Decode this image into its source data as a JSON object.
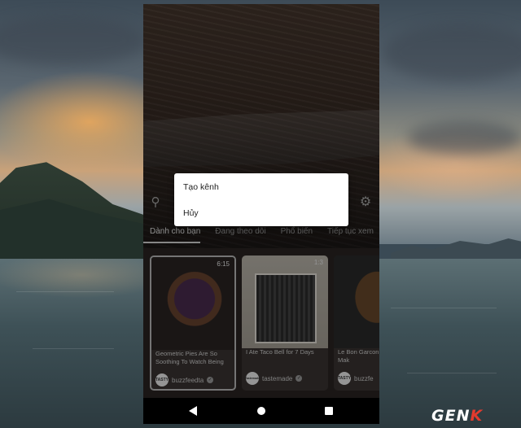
{
  "menu": {
    "items": [
      {
        "label": "Tạo kênh"
      },
      {
        "label": "Hủy"
      }
    ]
  },
  "tabs": [
    {
      "label": "Dành cho bạn",
      "active": true
    },
    {
      "label": "Đang theo dõi"
    },
    {
      "label": "Phổ biến"
    },
    {
      "label": "Tiếp tục xem"
    }
  ],
  "cards": [
    {
      "title": "Geometric Pies Are So Soothing To Watch Being",
      "duration": "6:15",
      "channel": "buzzfeedta",
      "avatar": "TASTY",
      "verified": true
    },
    {
      "title": "I Ate Taco Bell for 7 Days",
      "duration": "1:3",
      "channel": "tastemade",
      "avatar": "Tastemade",
      "verified": true
    },
    {
      "title": "Le Bon Garcon That Will Mak",
      "duration": "",
      "channel": "buzzfe",
      "avatar": "TASTY",
      "verified": false
    }
  ],
  "icons": {
    "search": "search-icon",
    "settings": "gear-icon",
    "back": "back-triangle-icon",
    "home": "home-circle-icon",
    "recents": "recents-square-icon"
  },
  "watermark": {
    "text_main": "GEN",
    "text_accent": "K"
  },
  "colors": {
    "menu_bg": "#ffffff",
    "logo_accent": "#e23a2e"
  }
}
